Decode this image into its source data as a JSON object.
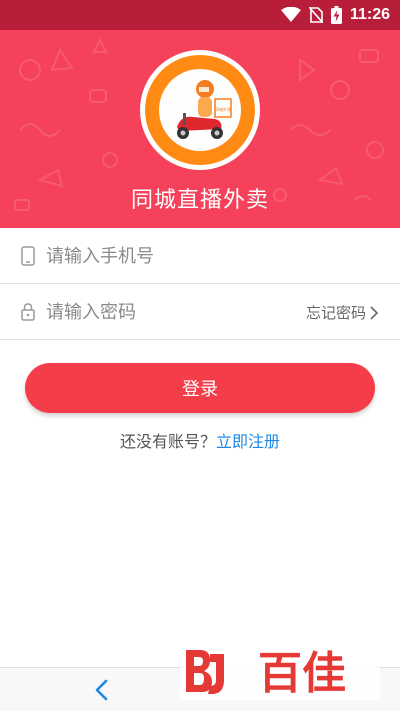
{
  "status_bar": {
    "time": "11:26",
    "icons": [
      "wifi-icon",
      "no-sim-icon",
      "battery-charging-icon"
    ]
  },
  "header": {
    "app_title": "同城直播外卖",
    "logo_sign_text": "同城外卖",
    "colors": {
      "header_bg": "#f5425a",
      "status_bg": "#b81d3a",
      "logo_ring": "#ff8a14"
    }
  },
  "form": {
    "phone": {
      "placeholder": "请输入手机号",
      "icon": "phone-icon"
    },
    "password": {
      "placeholder": "请输入密码",
      "icon": "lock-icon"
    },
    "forgot_label": "忘记密码"
  },
  "login": {
    "button_label": "登录",
    "color": "#f53d4a"
  },
  "register": {
    "prompt": "还没有账号？",
    "link": "立即注册",
    "link_color": "#1e88e5"
  },
  "nav": {
    "back_icon": "chevron-left-icon"
  },
  "watermark": {
    "text": "百佳"
  }
}
